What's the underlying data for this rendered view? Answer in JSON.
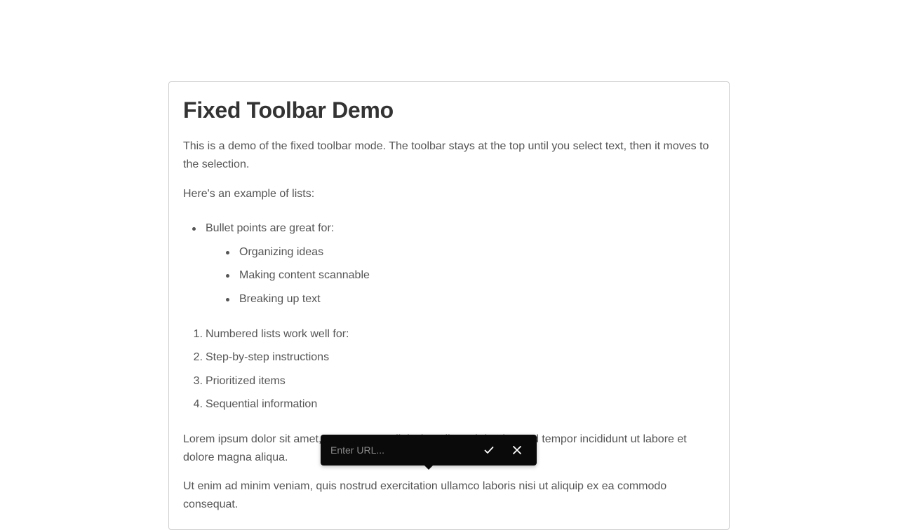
{
  "editor": {
    "title": "Fixed Toolbar Demo",
    "intro": "This is a demo of the fixed toolbar mode. The toolbar stays at the top until you select text, then it moves to the selection.",
    "lists_intro": "Here's an example of lists:",
    "bullet_list": {
      "item": "Bullet points are great for:",
      "sub_items": [
        "Organizing ideas",
        "Making content scannable",
        "Breaking up text"
      ]
    },
    "numbered_list": [
      "Numbered lists work well for:",
      "Step-by-step instructions",
      "Prioritized items",
      "Sequential information"
    ],
    "numbers": [
      "1.",
      "2.",
      "3.",
      "4."
    ],
    "lorem_1": "Lorem ipsum dolor sit amet, consectetur adipiscing elit, sed do eiusmod tempor incididunt ut labore et dolore magna aliqua.",
    "lorem_2": "Ut enim ad minim veniam, quis nostrud exercitation ullamco laboris nisi ut aliquip ex ea commodo consequat."
  },
  "link_popover": {
    "placeholder": "Enter URL...",
    "confirm_icon": "check-icon",
    "cancel_icon": "close-icon"
  }
}
